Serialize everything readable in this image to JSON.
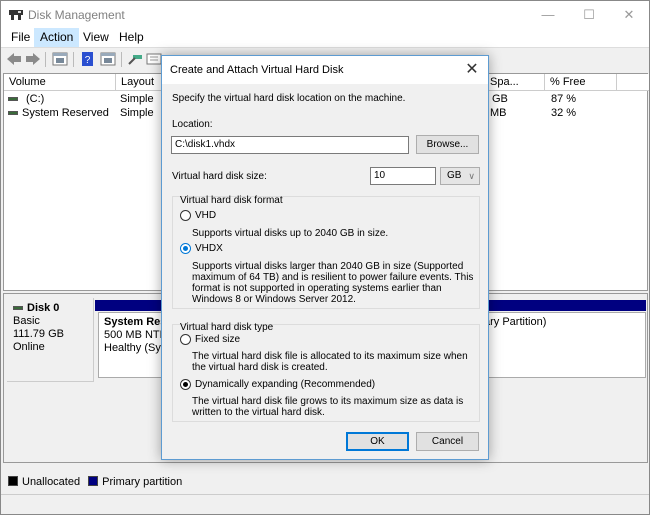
{
  "window": {
    "title": "Disk Management",
    "controls": {
      "minimize": "—",
      "maximize": "☐",
      "close": "✕"
    }
  },
  "menu": [
    {
      "label": "File",
      "active": false
    },
    {
      "label": "Action",
      "active": true
    },
    {
      "label": "View",
      "active": false
    },
    {
      "label": "Help",
      "active": false
    }
  ],
  "toolbar": {
    "icons": [
      "back-icon",
      "forward-icon",
      "show-hide-console-tree-icon",
      "help-icon",
      "show-hide-action-pane-icon",
      "connect-icon",
      "properties-icon"
    ]
  },
  "volume_list": {
    "columns": [
      "Volume",
      "Layout",
      "Spa...",
      "% Free",
      ""
    ],
    "rows": [
      {
        "volume": "(C:)",
        "layout": "Simple",
        "free_space": "GB",
        "pct_free": "87 %"
      },
      {
        "volume": "System Reserved",
        "layout": "Simple",
        "free_space": "MB",
        "pct_free": "32 %"
      }
    ]
  },
  "disk": {
    "name": "Disk 0",
    "type": "Basic",
    "size": "111.79 GB",
    "status": "Online",
    "partitions": [
      {
        "title": "System Rese",
        "line1": "500 MB NTFS",
        "line2": "Healthy (Syste"
      },
      {
        "title": "",
        "line1": "",
        "line2": "ary Partition)"
      }
    ]
  },
  "legend": [
    {
      "label": "Unallocated",
      "color": "#000000"
    },
    {
      "label": "Primary partition",
      "color": "#000080"
    }
  ],
  "dialog": {
    "title": "Create and Attach Virtual Hard Disk",
    "close": "✕",
    "instructions": "Specify the virtual hard disk location on the machine.",
    "location_label": "Location:",
    "location_value": "C:\\disk1.vhdx",
    "browse_label": "Browse...",
    "size_label": "Virtual hard disk size:",
    "size_value": "10",
    "size_unit": "GB",
    "format_group": {
      "title": "Virtual hard disk format",
      "options": [
        {
          "label": "VHD",
          "selected": false,
          "description": "Supports virtual disks up to 2040 GB in size."
        },
        {
          "label": "VHDX",
          "selected": true,
          "description": "Supports virtual disks larger than 2040 GB in size (Supported maximum of 64 TB) and is resilient to power failure events. This format is not supported in operating systems earlier than Windows 8 or Windows Server 2012."
        }
      ]
    },
    "type_group": {
      "title": "Virtual hard disk type",
      "options": [
        {
          "label": "Fixed size",
          "selected": false,
          "description": "The virtual hard disk file is allocated to its maximum size when the virtual hard disk is created."
        },
        {
          "label": "Dynamically expanding (Recommended)",
          "selected": true,
          "description": "The virtual hard disk file grows to its maximum size as data is written to the virtual hard disk."
        }
      ]
    },
    "ok_label": "OK",
    "cancel_label": "Cancel"
  }
}
